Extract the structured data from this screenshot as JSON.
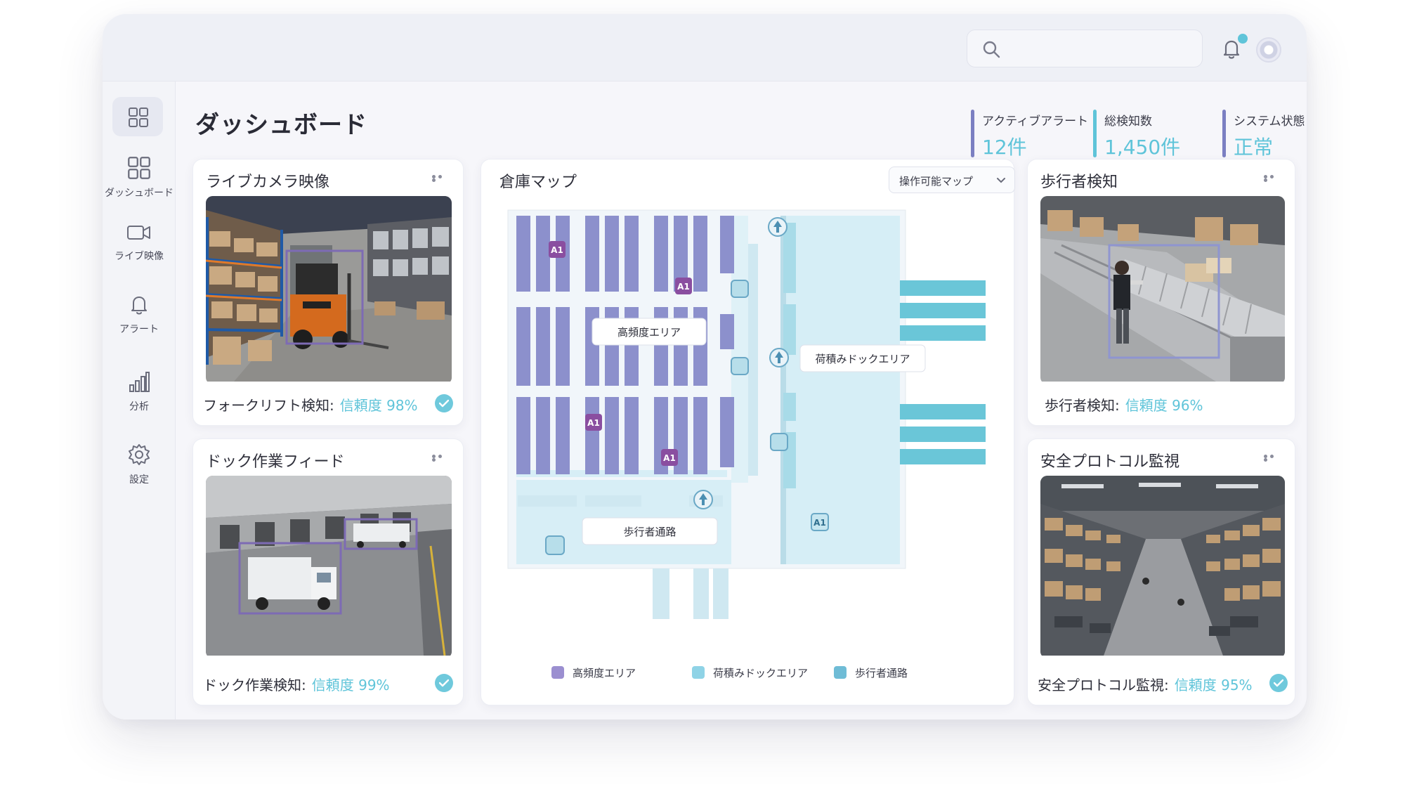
{
  "header": {
    "search": {
      "value": "",
      "placeholder": ""
    },
    "notification_dot_color": "#5fc4d9"
  },
  "sidebar": {
    "items": [
      {
        "label": "ダッシュボード",
        "icon": "dashboard-icon"
      },
      {
        "label": "ライブ映像",
        "icon": "video-camera-icon"
      },
      {
        "label": "アラート",
        "icon": "bell-icon"
      },
      {
        "label": "分析",
        "icon": "bar-chart-icon"
      },
      {
        "label": "設定",
        "icon": "gear-icon"
      }
    ]
  },
  "page": {
    "title": "ダッシュボード"
  },
  "stats": [
    {
      "label": "アクティブアラート",
      "value": "12件"
    },
    {
      "label": "総検知数",
      "value": "1,450件"
    },
    {
      "label": "システム状態",
      "value": "正常"
    }
  ],
  "cards": {
    "live_camera": {
      "title": "ライブカメラ映像",
      "caption": "フォークリフト検知:",
      "confidence": "信頼度 98%"
    },
    "dock_feed": {
      "title": "ドック作業フィード",
      "caption": "ドック作業検知:",
      "confidence": "信頼度 99%"
    },
    "pedestrian": {
      "title": "歩行者検知",
      "caption": "歩行者検知:",
      "confidence": "信頼度 96%"
    },
    "safety": {
      "title": "安全プロトコル監視",
      "caption": "安全プロトコル監視:",
      "confidence": "信頼度 95%"
    }
  },
  "map": {
    "title": "倉庫マップ",
    "selector": "操作可能マップ",
    "labels": {
      "high_freq": "高頻度エリア",
      "loading_dock": "荷積みドックエリア",
      "walkway": "歩行者通路",
      "marker": "A1"
    },
    "legend": [
      {
        "label": "高頻度エリア",
        "color": "#9b8fd0"
      },
      {
        "label": "荷積みドックエリア",
        "color": "#8fd3e6"
      },
      {
        "label": "歩行者通路",
        "color": "#6fbcd6"
      }
    ]
  },
  "colors": {
    "accent": "#5fc4d9",
    "rack": "#8c90cc",
    "marker": "#8a4ea0",
    "floor": "#d6eef6"
  }
}
